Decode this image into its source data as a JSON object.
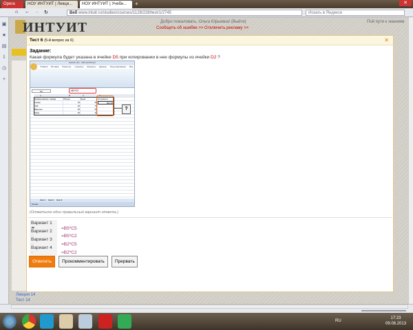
{
  "browser": {
    "tabs": [
      {
        "label": "Opera"
      },
      {
        "label": "НОУ ИНТУИТ | Лекци..."
      },
      {
        "label": "НОУ ИНТУИТ | Учебн..."
      }
    ],
    "address_prefix": "Веб",
    "url": "www.intuit.ru/studies/courses/1128/228/test/1/2745",
    "search_placeholder": "Искать в Яндексе"
  },
  "site": {
    "logo": "ИНТУИТ",
    "greeting": "Добро пожаловать, Ольга Юрьевна! (Выйти)",
    "links": "Сообщить об ошибке >>   Отключить рекламу >>",
    "top_right": "Пой пути к знаниям",
    "bottom_links": [
      "Лекция 14",
      "Тест 14"
    ]
  },
  "modal": {
    "title": "Тест 6",
    "subtitle": "(5-й вопрос из 6)",
    "task_label": "Задание:",
    "question_parts": [
      "Какая формула будет указана в ячейке ",
      "D5",
      " при копировании в нее формулы из ячейки ",
      "D2",
      " ?"
    ],
    "hint": "(Отметьте один правильный вариант ответа.)",
    "options": [
      {
        "label": "Вариант 1",
        "formula": "=B5*C5",
        "selected": true
      },
      {
        "label": "Вариант 2",
        "formula": "=B5*C2",
        "selected": false
      },
      {
        "label": "Вариант 3",
        "formula": "=B2*C5",
        "selected": false
      },
      {
        "label": "Вариант 4",
        "formula": "=B2*C2",
        "selected": false
      }
    ],
    "buttons": {
      "answer": "Ответить",
      "comment": "Прокомментировать",
      "abort": "Прервать"
    }
  },
  "excel": {
    "title": "Книга1.xlsx - Microsoft Excel",
    "ribbon_tabs": [
      "Главная",
      "Вставка",
      "Разметка страницы",
      "Формулы",
      "Данные",
      "Рецензирование",
      "Вид"
    ],
    "name_box": "D2",
    "formula": "=B2*C2",
    "columns": [
      "A",
      "B",
      "C",
      "D",
      "E",
      "F",
      "G",
      "H",
      "I"
    ],
    "headers": [
      "Наименование товара",
      "Объем",
      "Цена",
      "Стоимость"
    ],
    "rows": [
      [
        "Сахар",
        "10",
        "50",
        "500,00"
      ],
      [
        "Чай",
        "20",
        "70",
        ""
      ],
      [
        "Варенье",
        "30",
        "60",
        ""
      ],
      [
        "Мука",
        "40",
        "30",
        ""
      ]
    ],
    "callout": "?",
    "sheet_tabs": [
      "Лист1",
      "Лист2",
      "Лист3"
    ],
    "status": "Готово"
  },
  "taskbar": {
    "lang": "RU",
    "time": "17:23",
    "date": "09.06.2013"
  }
}
